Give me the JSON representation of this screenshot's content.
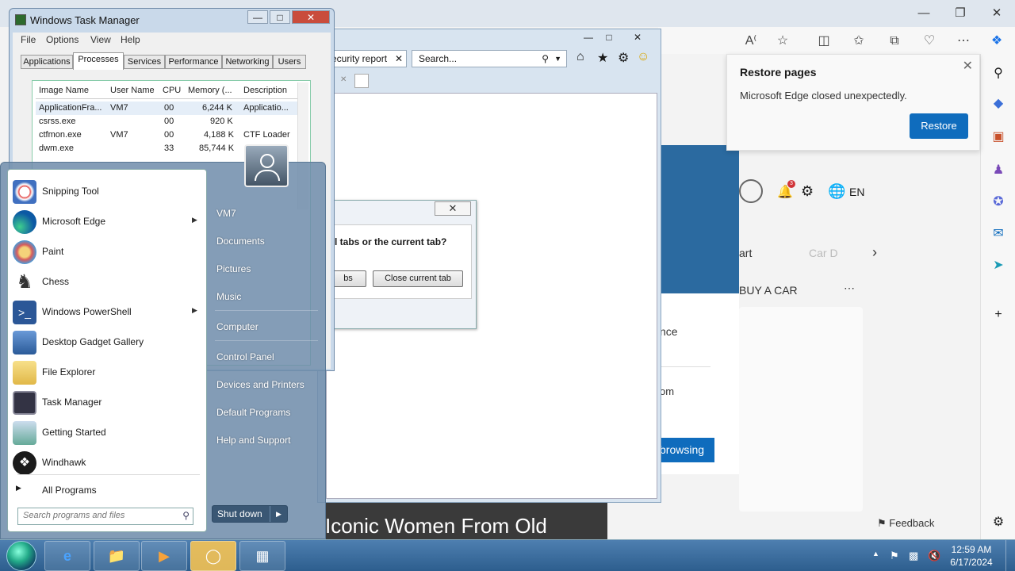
{
  "edge": {
    "restore_title": "Restore pages",
    "restore_message": "Microsoft Edge closed unexpectedly.",
    "restore_button": "Restore",
    "language": "EN",
    "notification_count": "3",
    "news_category_partial": "art",
    "news_category_partial2": "Car D",
    "news_section": "BUY A CAR",
    "more_ellipsis": "⋯",
    "browse_button_partial": "browsing",
    "dialog_text_partial_1": "nce",
    "dialog_text_partial_2": "om",
    "headline_partial": "Iconic Women From Old",
    "feedback": "Feedback"
  },
  "ie": {
    "tab_partial": "ecurity report",
    "search_placeholder": "Search...",
    "dialog": {
      "question_partial": "l tabs or the current tab?",
      "btn_other_partial": "bs",
      "btn_close_current": "Close current tab"
    }
  },
  "task_manager": {
    "title": "Windows Task Manager",
    "menu": [
      "File",
      "Options",
      "View",
      "Help"
    ],
    "tabs": [
      "Applications",
      "Processes",
      "Services",
      "Performance",
      "Networking",
      "Users"
    ],
    "active_tab": "Processes",
    "columns": [
      "Image Name",
      "User Name",
      "CPU",
      "Memory (...",
      "Description"
    ],
    "rows": [
      {
        "image": "ApplicationFra...",
        "user": "VM7",
        "cpu": "00",
        "mem": "6,244 K",
        "desc": "Applicatio..."
      },
      {
        "image": "csrss.exe",
        "user": "",
        "cpu": "00",
        "mem": "920 K",
        "desc": ""
      },
      {
        "image": "ctfmon.exe",
        "user": "VM7",
        "cpu": "00",
        "mem": "4,188 K",
        "desc": "CTF Loader"
      },
      {
        "image": "dwm.exe",
        "user": "",
        "cpu": "33",
        "mem": "85,744 K",
        "desc": ""
      }
    ]
  },
  "start_menu": {
    "programs": [
      {
        "label": "Snipping Tool",
        "icon": "snipping-tool-icon",
        "submenu": false
      },
      {
        "label": "Microsoft Edge",
        "icon": "edge-icon",
        "submenu": true
      },
      {
        "label": "Paint",
        "icon": "paint-icon",
        "submenu": false
      },
      {
        "label": "Chess",
        "icon": "chess-icon",
        "submenu": false
      },
      {
        "label": "Windows PowerShell",
        "icon": "powershell-icon",
        "submenu": true
      },
      {
        "label": "Desktop Gadget Gallery",
        "icon": "gadget-icon",
        "submenu": false
      },
      {
        "label": "File Explorer",
        "icon": "folder-icon",
        "submenu": false
      },
      {
        "label": "Task Manager",
        "icon": "task-manager-icon",
        "submenu": false
      },
      {
        "label": "Getting Started",
        "icon": "getting-started-icon",
        "submenu": false
      },
      {
        "label": "Windhawk",
        "icon": "windhawk-icon",
        "submenu": false
      }
    ],
    "all_programs": "All Programs",
    "search_placeholder": "Search programs and files",
    "right_items": [
      "VM7",
      "Documents",
      "Pictures",
      "Music",
      "Computer",
      "Control Panel",
      "Devices and Printers",
      "Default Programs",
      "Help and Support"
    ],
    "shutdown": "Shut down"
  },
  "taskbar": {
    "time": "12:59 AM",
    "date": "6/17/2024"
  }
}
